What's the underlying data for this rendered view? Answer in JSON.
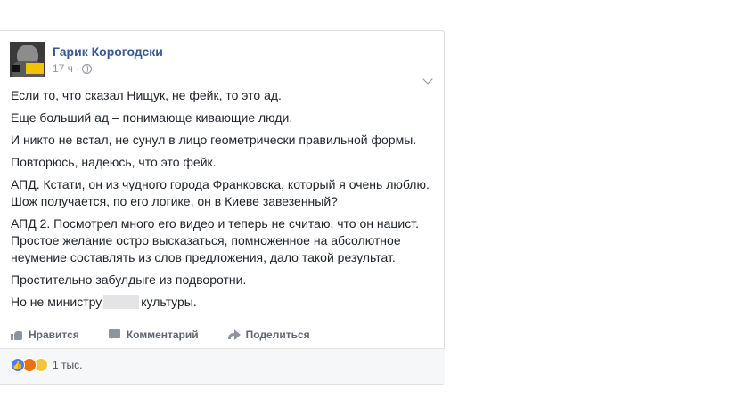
{
  "post": {
    "author": "Гарик Корогодски",
    "time": "17 ч",
    "separator": "·",
    "paragraphs": [
      "Если то, что сказал Нищук, не фейк, то это ад.",
      "Еще больший ад – понимающе кивающие люди.",
      "И никто не встал, не сунул в лицо геометрически правильной формы.",
      "Повторюсь, надеюсь, что это фейк.",
      "АПД. Кстати, он из чудного города Франковска, который я очень люблю. Шож получается, по его логике, он в Киеве завезенный?",
      "АПД 2. Посмотрел много его видео и теперь не считаю, что он нацист. Простое желание остро высказаться, помноженное на абсолютное неумение составлять из слов предложения, дало такой результат.",
      "Простительно забулдыге из подворотни."
    ],
    "last_line": {
      "before": "Но не министру",
      "after": "культуры."
    }
  },
  "actions": {
    "like": "Нравится",
    "comment": "Комментарий",
    "share": "Поделиться"
  },
  "reactions": {
    "count": "1 тыс.",
    "types": [
      "like-icon",
      "angry-icon",
      "sad-icon"
    ]
  },
  "colors": {
    "author": "#365899",
    "meta": "#90949c",
    "action": "#616770",
    "like": "#4a7cf0",
    "angry": "#e9710f",
    "sad": "#f7c53a"
  }
}
